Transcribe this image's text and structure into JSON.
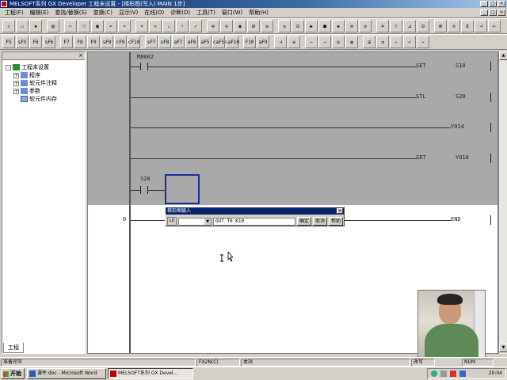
{
  "window": {
    "title": "MELSOFT系列 GX Developer 工程未设置 - [梯形图(写入)    MAIN    1步]"
  },
  "menu": {
    "items": [
      "工程(F)",
      "编辑(E)",
      "查找/替换(S)",
      "变换(C)",
      "显示(V)",
      "在线(O)",
      "诊断(D)",
      "工具(T)",
      "窗口(W)",
      "帮助(H)"
    ]
  },
  "toolbar2": {
    "labels": [
      "F5",
      "sF5",
      "F6",
      "sF6",
      "F7",
      "F8",
      "F9",
      "sF9",
      "cF9",
      "cF10",
      "sF7",
      "sF8",
      "aF7",
      "aF8",
      "aF5",
      "caF5",
      "caF10",
      "F10",
      "aF9"
    ]
  },
  "tree": {
    "items": [
      {
        "label": "工程未设置",
        "expander": "-"
      },
      {
        "label": "程序",
        "expander": "+"
      },
      {
        "label": "软元件注释",
        "expander": "+"
      },
      {
        "label": "参数",
        "expander": "+"
      },
      {
        "label": "软元件内存",
        "expander": ""
      }
    ],
    "tab": "工程"
  },
  "ladder": {
    "m8002": "M8002",
    "rung1_instr": "SET",
    "rung1_op": "S10",
    "rung2_instr": "STL",
    "rung2_op": "S20",
    "rung3_coil": "Y014",
    "rung4_instr": "SET",
    "rung4_op": "Y010",
    "s20": "S20",
    "step": "0",
    "end_instr": "END"
  },
  "dialog": {
    "title": "梯形图输入",
    "icon": "LD",
    "input_value": "OUT  T0  K10",
    "ok_label": "确定",
    "cancel_label": "取消",
    "help_label": "帮助"
  },
  "statusbar": {
    "ready": "准备完毕",
    "cpu": "FX2N(C)",
    "station": "本站",
    "mode": "改写",
    "num": "NUM"
  },
  "taskbar": {
    "start": "开始",
    "task1": "课件.doc - Microsoft Word",
    "task2": "MELSOFT系列 GX Devel...",
    "clock": "20:04"
  }
}
